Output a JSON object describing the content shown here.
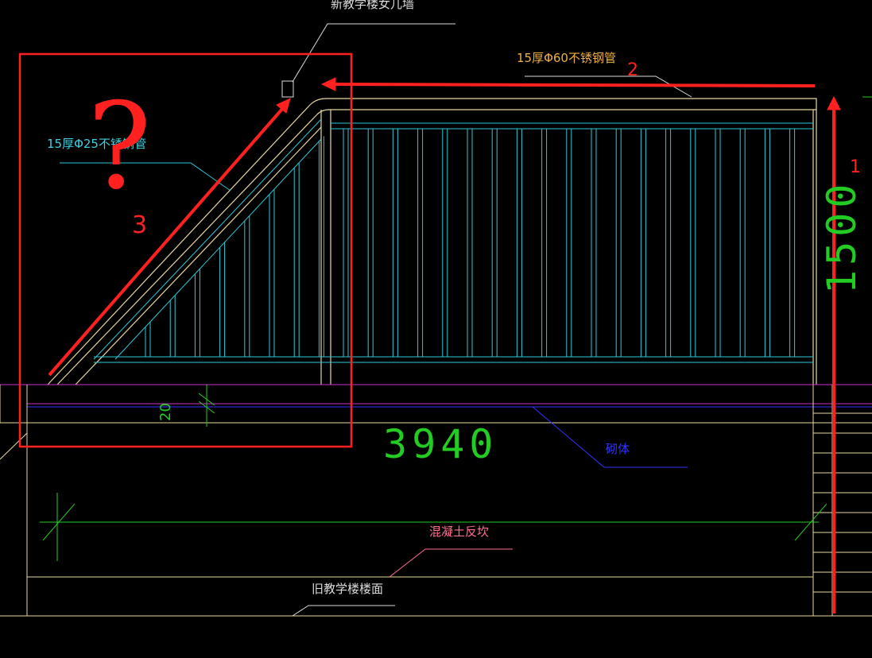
{
  "labels": {
    "top_note": "新教学楼女儿墙",
    "pipe_60": "15厚Φ60不锈钢管",
    "pipe_25": "15厚Φ25不锈钢管",
    "dim_3940": "3940",
    "dim_1500": "1500",
    "dim_20": "20",
    "masonry": "砌体",
    "concrete": "混凝土反坎",
    "old_floor": "旧教学楼楼面"
  },
  "annotations": {
    "n1": "1",
    "n2": "2",
    "n3": "3",
    "question": "?"
  },
  "colors": {
    "background": "#000000",
    "rail_line": "#e8d8a0",
    "baluster": "#30c8d8",
    "dimension": "#22cc22",
    "slab_magenta": "#cc33cc",
    "masonry_blue": "#3333ff",
    "annotation_red": "#ff2020",
    "leader_white": "#dddddd",
    "label_orange": "#f0b040",
    "label_cyan": "#40d0e0",
    "label_pink": "#ff7090"
  }
}
